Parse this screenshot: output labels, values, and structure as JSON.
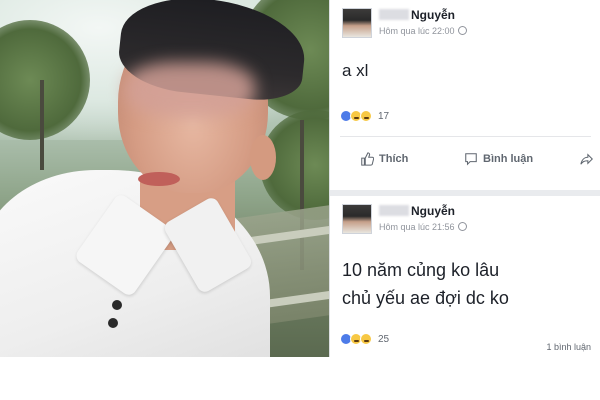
{
  "posts": [
    {
      "author_name": "Nguyễn",
      "timestamp": "Hôm qua lúc 22:00",
      "text": "a xl",
      "reaction_count": "17",
      "actions": {
        "like": "Thích",
        "comment": "Bình luận"
      }
    },
    {
      "author_name": "Nguyễn",
      "timestamp": "Hôm qua lúc 21:56",
      "text": "10 năm củng ko lâu\nchủ yếu ae đợi dc ko",
      "reaction_count": "25",
      "comment_count": "1 bình luận"
    }
  ],
  "icons": {
    "like": "thumbs-up-icon",
    "comment": "speech-bubble-icon",
    "share": "share-arrow-icon",
    "privacy": "globe-icon"
  },
  "colors": {
    "name": "#1d2129",
    "meta": "#90949c",
    "like_reaction": "#4d7be8",
    "emoji_yellow": "#f7c844",
    "separator": "#e9ebee"
  }
}
